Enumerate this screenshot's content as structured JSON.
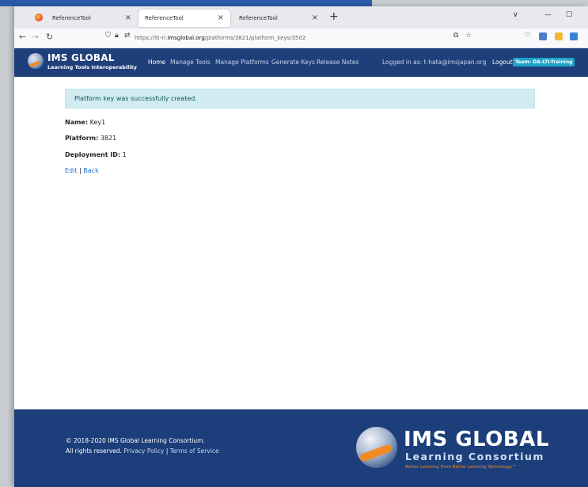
{
  "browser": {
    "tabs": [
      {
        "title": "ReferenceTool",
        "close": "×"
      },
      {
        "title": "ReferenceTool",
        "close": "×"
      },
      {
        "title": "ReferenceTool",
        "close": "×"
      }
    ],
    "new_tab": "+",
    "window_controls": {
      "dropdown": "∨",
      "minimize": "—",
      "maximize": "☐"
    },
    "url_scheme": "https://lti-ri.",
    "url_host": "imsglobal.org",
    "url_path": "/platforms/3821/platform_keys/3502"
  },
  "header": {
    "brand_title": "IMS GLOBAL",
    "brand_subtitle": "Learning Tools Interoperability",
    "nav": [
      "Home",
      "Manage Tools",
      "Manage Platforms",
      "Generate Keys",
      "Release Notes"
    ],
    "logged_in": "Logged in as: t-hata@imsjapan.org",
    "logout": "Logout",
    "team": "Team: DA-LTI-Training"
  },
  "content": {
    "alert": "Platform key was successfully created.",
    "name_label": "Name:",
    "name_value": " Key1",
    "platform_label": "Platform:",
    "platform_value": " 3821",
    "deployment_label": "Deployment ID:",
    "deployment_value": " 1",
    "edit": "Edit",
    "sep": " | ",
    "back": "Back"
  },
  "footer": {
    "copyright": "© 2018-2020 IMS Global Learning Consortium.",
    "rights": "All rights reserved.",
    "privacy": "Privacy Policy",
    "sep": " | ",
    "terms": "Terms of Service",
    "logo_title": "IMS GLOBAL",
    "logo_reg": "®",
    "logo_subtitle": "Learning Consortium",
    "logo_tagline": "Better Learning From Better Learning Technology™"
  },
  "colors": {
    "header_bg": "#1e3f7a",
    "footer_bg": "#1c3e7a",
    "alert_bg": "#d1ecf1",
    "link": "#1a73c8",
    "badge": "#1fa3c6",
    "accent_orange": "#f08a24"
  }
}
